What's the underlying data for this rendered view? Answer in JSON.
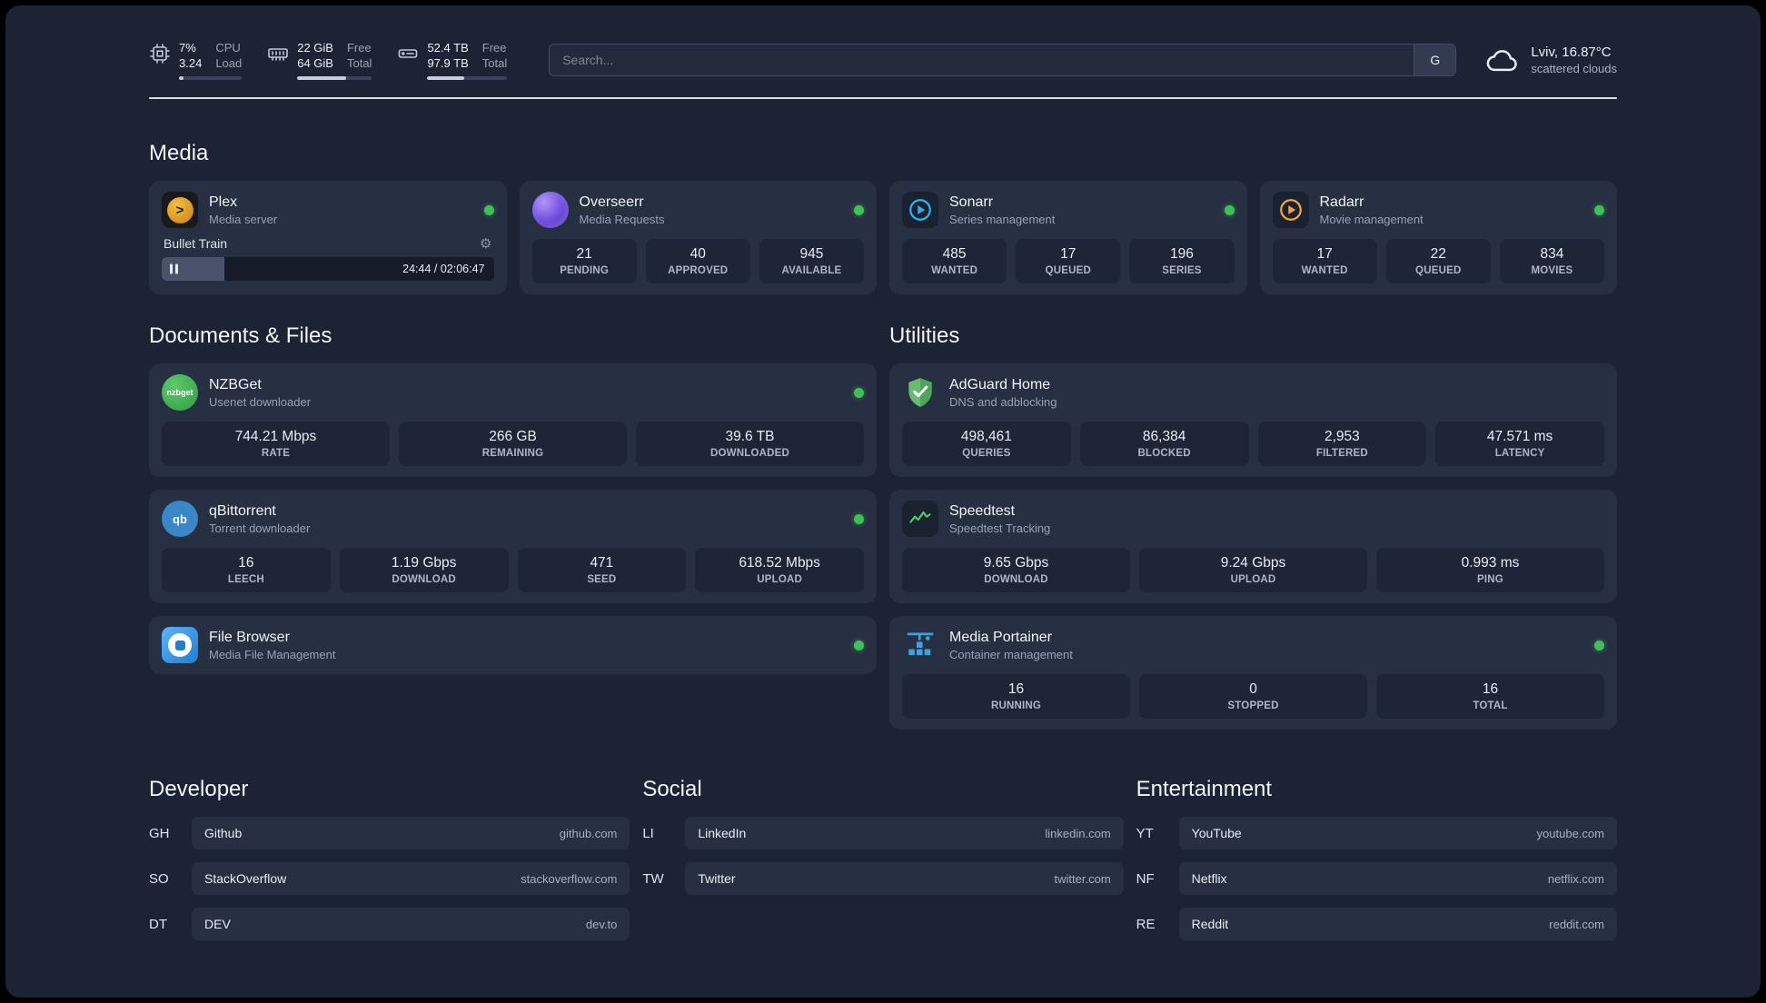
{
  "topbar": {
    "cpu": {
      "value_top": "7%",
      "value_bottom": "3.24",
      "label_top": "CPU",
      "label_bottom": "Load",
      "progress_percent": 7
    },
    "ram": {
      "value_top": "22 GiB",
      "value_bottom": "64 GiB",
      "label_top": "Free",
      "label_bottom": "Total",
      "progress_percent": 66
    },
    "disk": {
      "value_top": "52.4 TB",
      "value_bottom": "97.9 TB",
      "label_top": "Free",
      "label_bottom": "Total",
      "progress_percent": 46
    },
    "search": {
      "placeholder": "Search...",
      "engine_button": "G"
    },
    "weather": {
      "location": "Lviv, 16.87°C",
      "condition": "scattered clouds"
    }
  },
  "sections": {
    "media": "Media",
    "documents": "Documents & Files",
    "utilities": "Utilities",
    "developer": "Developer",
    "social": "Social",
    "entertainment": "Entertainment"
  },
  "apps": {
    "plex": {
      "name": "Plex",
      "subtitle": "Media server",
      "now_playing": "Bullet Train",
      "time": "24:44 / 02:06:47",
      "progress_percent": 19
    },
    "overseerr": {
      "name": "Overseerr",
      "subtitle": "Media Requests",
      "stats": [
        {
          "value": "21",
          "label": "PENDING"
        },
        {
          "value": "40",
          "label": "APPROVED"
        },
        {
          "value": "945",
          "label": "AVAILABLE"
        }
      ]
    },
    "sonarr": {
      "name": "Sonarr",
      "subtitle": "Series management",
      "stats": [
        {
          "value": "485",
          "label": "WANTED"
        },
        {
          "value": "17",
          "label": "QUEUED"
        },
        {
          "value": "196",
          "label": "SERIES"
        }
      ]
    },
    "radarr": {
      "name": "Radarr",
      "subtitle": "Movie management",
      "stats": [
        {
          "value": "17",
          "label": "WANTED"
        },
        {
          "value": "22",
          "label": "QUEUED"
        },
        {
          "value": "834",
          "label": "MOVIES"
        }
      ]
    },
    "nzbget": {
      "name": "NZBGet",
      "subtitle": "Usenet downloader",
      "stats": [
        {
          "value": "744.21 Mbps",
          "label": "RATE"
        },
        {
          "value": "266 GB",
          "label": "REMAINING"
        },
        {
          "value": "39.6 TB",
          "label": "DOWNLOADED"
        }
      ]
    },
    "qbittorrent": {
      "name": "qBittorrent",
      "subtitle": "Torrent downloader",
      "stats": [
        {
          "value": "16",
          "label": "LEECH"
        },
        {
          "value": "1.19 Gbps",
          "label": "DOWNLOAD"
        },
        {
          "value": "471",
          "label": "SEED"
        },
        {
          "value": "618.52 Mbps",
          "label": "UPLOAD"
        }
      ]
    },
    "filebrowser": {
      "name": "File Browser",
      "subtitle": "Media File Management"
    },
    "adguard": {
      "name": "AdGuard Home",
      "subtitle": "DNS and adblocking",
      "stats": [
        {
          "value": "498,461",
          "label": "QUERIES"
        },
        {
          "value": "86,384",
          "label": "BLOCKED"
        },
        {
          "value": "2,953",
          "label": "FILTERED"
        },
        {
          "value": "47.571 ms",
          "label": "LATENCY"
        }
      ]
    },
    "speedtest": {
      "name": "Speedtest",
      "subtitle": "Speedtest Tracking",
      "stats": [
        {
          "value": "9.65 Gbps",
          "label": "DOWNLOAD"
        },
        {
          "value": "9.24 Gbps",
          "label": "UPLOAD"
        },
        {
          "value": "0.993 ms",
          "label": "PING"
        }
      ]
    },
    "portainer": {
      "name": "Media Portainer",
      "subtitle": "Container management",
      "stats": [
        {
          "value": "16",
          "label": "RUNNING"
        },
        {
          "value": "0",
          "label": "STOPPED"
        },
        {
          "value": "16",
          "label": "TOTAL"
        }
      ]
    }
  },
  "bookmarks": {
    "developer": [
      {
        "abbr": "GH",
        "name": "Github",
        "url": "github.com"
      },
      {
        "abbr": "SO",
        "name": "StackOverflow",
        "url": "stackoverflow.com"
      },
      {
        "abbr": "DT",
        "name": "DEV",
        "url": "dev.to"
      }
    ],
    "social": [
      {
        "abbr": "LI",
        "name": "LinkedIn",
        "url": "linkedin.com"
      },
      {
        "abbr": "TW",
        "name": "Twitter",
        "url": "twitter.com"
      }
    ],
    "entertainment": [
      {
        "abbr": "YT",
        "name": "YouTube",
        "url": "youtube.com"
      },
      {
        "abbr": "NF",
        "name": "Netflix",
        "url": "netflix.com"
      },
      {
        "abbr": "RE",
        "name": "Reddit",
        "url": "reddit.com"
      }
    ]
  },
  "icons": {
    "gear": "⚙",
    "plex_chevron": ">",
    "nzbget_text": "nzbget",
    "qbittorrent_text": "qb"
  },
  "colors": {
    "status_online": "#40c057",
    "plex": "#e5a00d",
    "overseerr": "#6741d9",
    "sonarr": "#35b0e8",
    "radarr": "#f2a33c",
    "nzbget": "#2f9e44",
    "qbittorrent": "#3a87c8",
    "filebrowser": "#1f7fd0",
    "adguard": "#68bc71",
    "speedtest": "#51cf66",
    "portainer": "#3fa2e0"
  }
}
